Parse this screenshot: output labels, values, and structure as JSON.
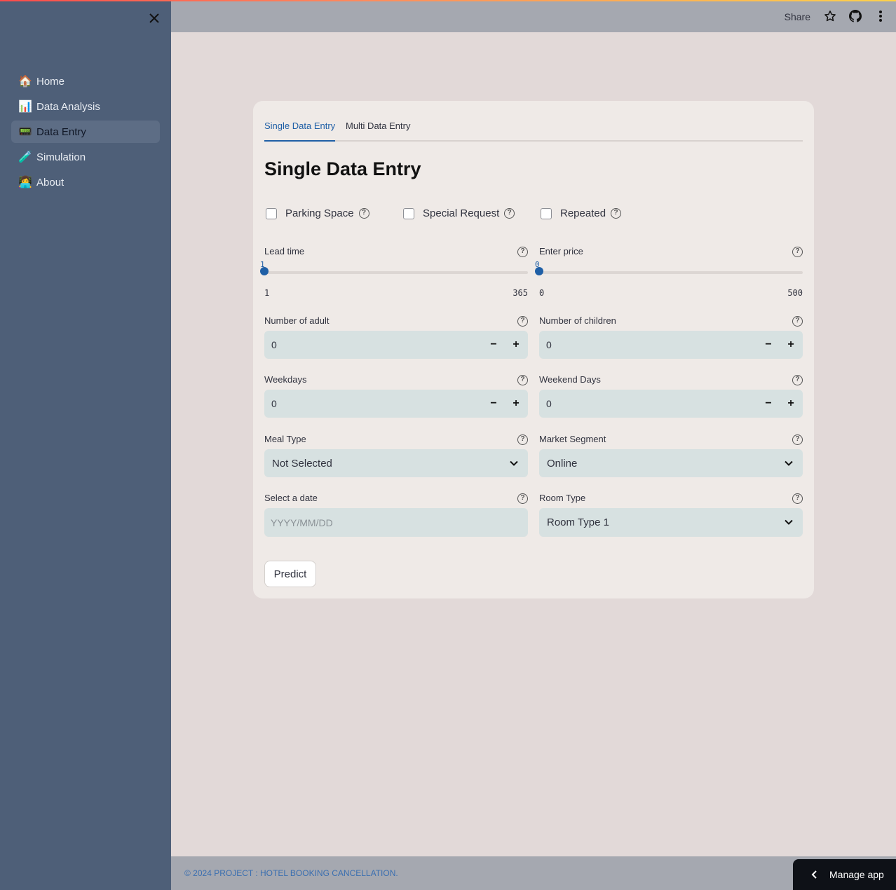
{
  "sidebar": {
    "close_icon": "close-icon",
    "items": [
      {
        "emoji": "🏠",
        "icon": "house-icon",
        "label": "Home"
      },
      {
        "emoji": "📊",
        "icon": "bar-chart-icon",
        "label": "Data Analysis"
      },
      {
        "emoji": "📟",
        "icon": "pager-icon",
        "label": "Data Entry",
        "active": true
      },
      {
        "emoji": "🧪",
        "icon": "test-tube-icon",
        "label": "Simulation"
      },
      {
        "emoji": "👩‍💻",
        "icon": "technologist-icon",
        "label": "About"
      }
    ]
  },
  "header": {
    "share_label": "Share",
    "icons": [
      "star-icon",
      "github-icon",
      "more-vertical-icon"
    ]
  },
  "tabs": [
    {
      "label": "Single Data Entry",
      "active": true
    },
    {
      "label": "Multi Data Entry",
      "active": false
    }
  ],
  "form": {
    "title": "Single Data Entry",
    "checkboxes": [
      {
        "label": "Parking Space",
        "checked": false
      },
      {
        "label": "Special Request",
        "checked": false
      },
      {
        "label": "Repeated",
        "checked": false
      }
    ],
    "sliders": {
      "lead_time": {
        "label": "Lead time",
        "value": "1",
        "min": "1",
        "max": "365"
      },
      "price": {
        "label": "Enter price",
        "value": "0",
        "min": "0",
        "max": "500"
      }
    },
    "numbers": {
      "adults": {
        "label": "Number of adult",
        "value": "0"
      },
      "children": {
        "label": "Number of children",
        "value": "0"
      },
      "weekdays": {
        "label": "Weekdays",
        "value": "0"
      },
      "weekend": {
        "label": "Weekend Days",
        "value": "0"
      }
    },
    "stepper": {
      "minus": "−",
      "plus": "+"
    },
    "selects": {
      "meal": {
        "label": "Meal Type",
        "value": "Not Selected"
      },
      "market": {
        "label": "Market Segment",
        "value": "Online"
      },
      "room": {
        "label": "Room Type",
        "value": "Room Type 1"
      }
    },
    "date": {
      "label": "Select a date",
      "placeholder": "YYYY/MM/DD",
      "value": ""
    },
    "help_glyph": "?",
    "predict_label": "Predict"
  },
  "footer": {
    "text": "© 2024 PROJECT : HOTEL BOOKING CANCELLATION.",
    "manage_label": "Manage app"
  },
  "colors": {
    "accent": "#1f5fa6",
    "sidebar_bg": "#4e5f78",
    "main_bg": "#e2d9d8",
    "card_bg": "#efeae7",
    "input_bg": "#d7e1e1",
    "header_bg": "#a5a8b0"
  }
}
